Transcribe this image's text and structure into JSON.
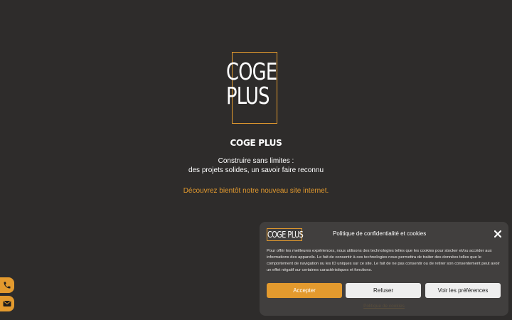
{
  "logo": {
    "line1": "COGE",
    "line2": "PLUS"
  },
  "brand_name": "COGE PLUS",
  "tagline": {
    "line1": "Construire sans limites :",
    "line2": "des projets solides, un savoir faire reconnu"
  },
  "coming_soon": "Découvrez bientôt notre nouveau site internet.",
  "colors": {
    "background": "#2e2c2b",
    "accent": "#e39a2e",
    "panel": "#413f3e"
  },
  "side_buttons": [
    {
      "icon": "phone-icon"
    },
    {
      "icon": "envelope-icon"
    }
  ],
  "cookie_banner": {
    "logo_text": "COGE PLUS",
    "title": "Politique de confidentialité et cookies",
    "body": "Pour offrir les meilleures expériences, nous utilisons des technologies telles que les cookies pour stocker et/ou accéder aux informations des appareils. Le fait de consentir à ces technologies nous permettra de traiter des données telles que le comportement de navigation ou les ID uniques sur ce site. Le fait de ne pas consentir ou de retirer son consentement peut avoir un effet négatif sur certaines caractéristiques et fonctions.",
    "accept_label": "Accepter",
    "refuse_label": "Refuser",
    "prefs_label": "Voir les préférences",
    "policy_link": "Politique de cookies"
  }
}
